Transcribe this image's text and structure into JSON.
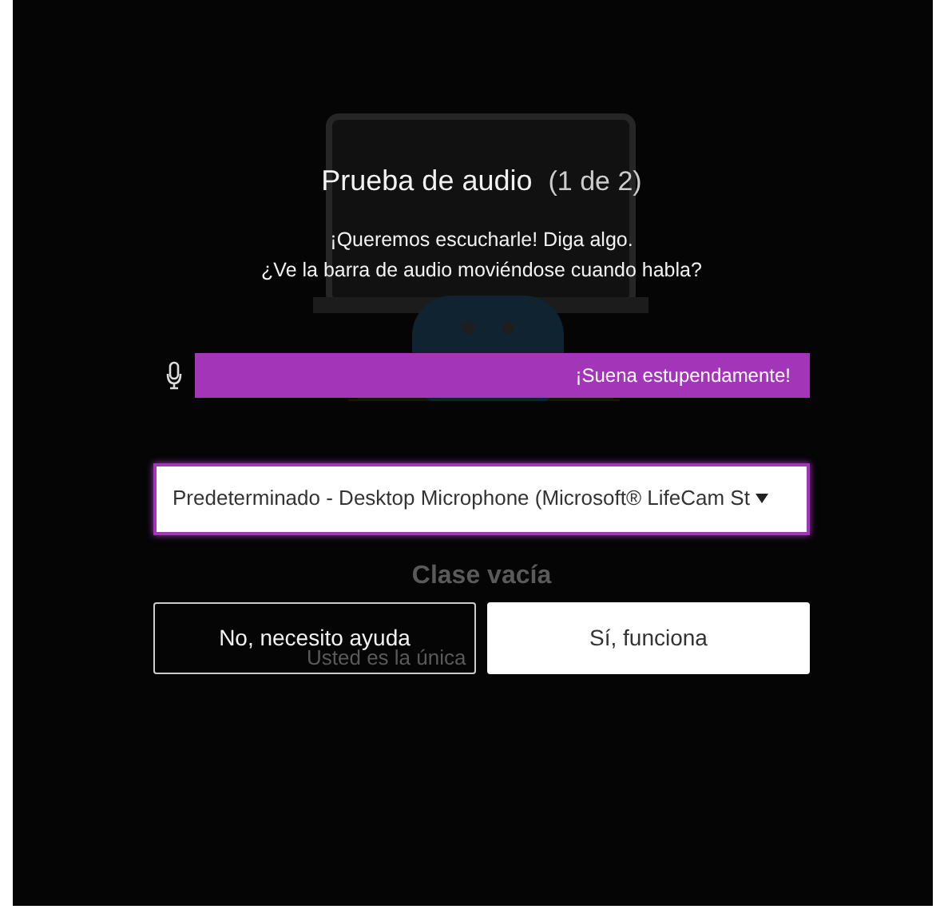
{
  "title": "Prueba de audio",
  "step": "(1 de 2)",
  "prompt_lines": [
    "¡Queremos escucharle! Diga algo.",
    "¿Ve la barra de audio moviéndose cuando habla?"
  ],
  "level_meter": {
    "level": 1,
    "label": "¡Suena estupendamente!"
  },
  "device_select": {
    "value": "Predeterminado - Desktop Microphone (Microsoft® LifeCam St"
  },
  "background": {
    "heading": "Clase vacía",
    "text": "Usted es la única"
  },
  "buttons": [
    {
      "label": "No, necesito ayuda",
      "kind": "outline"
    },
    {
      "label": "Sí, funciona",
      "kind": "primary"
    }
  ]
}
